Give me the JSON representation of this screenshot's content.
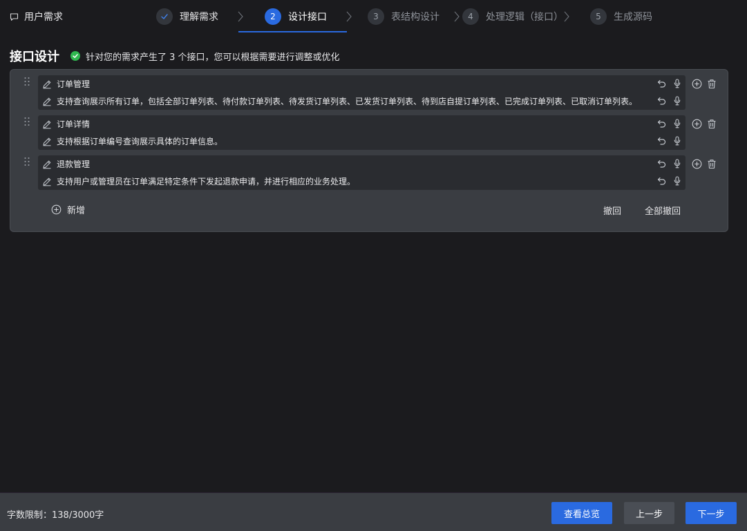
{
  "header": {
    "requirements_link": "用户需求",
    "steps": [
      {
        "number": "",
        "label": "理解需求",
        "state": "done"
      },
      {
        "number": "2",
        "label": "设计接口",
        "state": "active"
      },
      {
        "number": "3",
        "label": "表结构设计",
        "state": "todo"
      },
      {
        "number": "4",
        "label": "处理逻辑（接口）",
        "state": "todo"
      },
      {
        "number": "5",
        "label": "生成源码",
        "state": "todo"
      }
    ]
  },
  "main": {
    "title": "接口设计",
    "notice": "针对您的需求产生了 3 个接口，您可以根据需要进行调整或优化",
    "interfaces": [
      {
        "name": "订单管理",
        "description": "支持查询展示所有订单，包括全部订单列表、待付款订单列表、待发货订单列表、已发货订单列表、待到店自提订单列表、已完成订单列表、已取消订单列表。"
      },
      {
        "name": "订单详情",
        "description": "支持根据订单编号查询展示具体的订单信息。"
      },
      {
        "name": "退款管理",
        "description": "支持用户或管理员在订单满足特定条件下发起退款申请，并进行相应的业务处理。"
      }
    ],
    "add_label": "新增",
    "undo_label": "撤回",
    "undo_all_label": "全部撤回"
  },
  "footer": {
    "char_limit": "字数限制：138/3000字",
    "overview_label": "查看总览",
    "prev_label": "上一步",
    "next_label": "下一步"
  },
  "colors": {
    "accent": "#2a6ae0",
    "success": "#2fb84f",
    "panel": "#3a3d42",
    "background": "#1b1b1e"
  },
  "icons": [
    "comment-icon",
    "check-icon",
    "chevron-right-icon",
    "drag-handle-icon",
    "pencil-icon",
    "undo-icon",
    "microphone-icon",
    "plus-circle-icon",
    "trash-icon"
  ]
}
